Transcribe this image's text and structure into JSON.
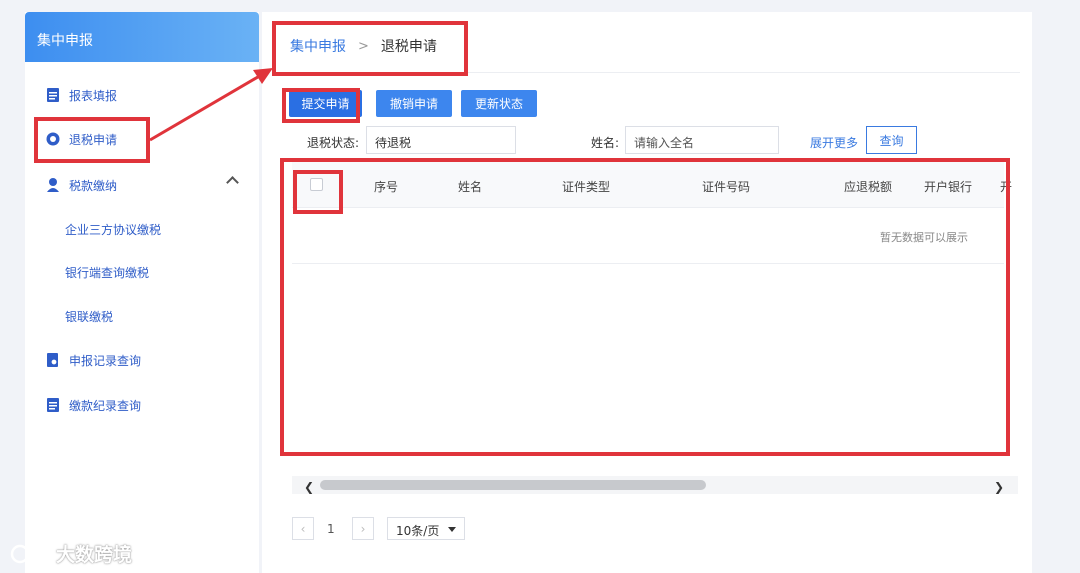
{
  "sidebar": {
    "title": "集中申报",
    "items": [
      {
        "label": "报表填报",
        "icon": "document-icon"
      },
      {
        "label": "退税申请",
        "icon": "refund-icon"
      },
      {
        "label": "税款缴纳",
        "icon": "tax-payment-icon"
      },
      {
        "label": "企业三方协议缴税"
      },
      {
        "label": "银行端查询缴税"
      },
      {
        "label": "银联缴税"
      },
      {
        "label": "申报记录查询",
        "icon": "record-search-icon"
      },
      {
        "label": "缴款纪录查询",
        "icon": "document-icon"
      }
    ]
  },
  "breadcrumb": {
    "parent": "集中申报",
    "separator": ">",
    "current": "退税申请"
  },
  "toolbar": {
    "submit": "提交申请",
    "revoke": "撤销申请",
    "update": "更新状态"
  },
  "filters": {
    "status_label": "退税状态:",
    "status_value": "待退税",
    "name_label": "姓名:",
    "name_placeholder": "请输入全名",
    "more": "展开更多",
    "query": "查询"
  },
  "table": {
    "columns": [
      "序号",
      "姓名",
      "证件类型",
      "证件号码",
      "应退税额",
      "开户银行",
      "开"
    ],
    "empty_text": "暂无数据可以展示"
  },
  "pagination": {
    "page": "1",
    "page_size": "10条/页"
  },
  "watermark": "大数跨境",
  "colors": {
    "accent": "#3d86ee",
    "annotation": "#e0343b"
  }
}
